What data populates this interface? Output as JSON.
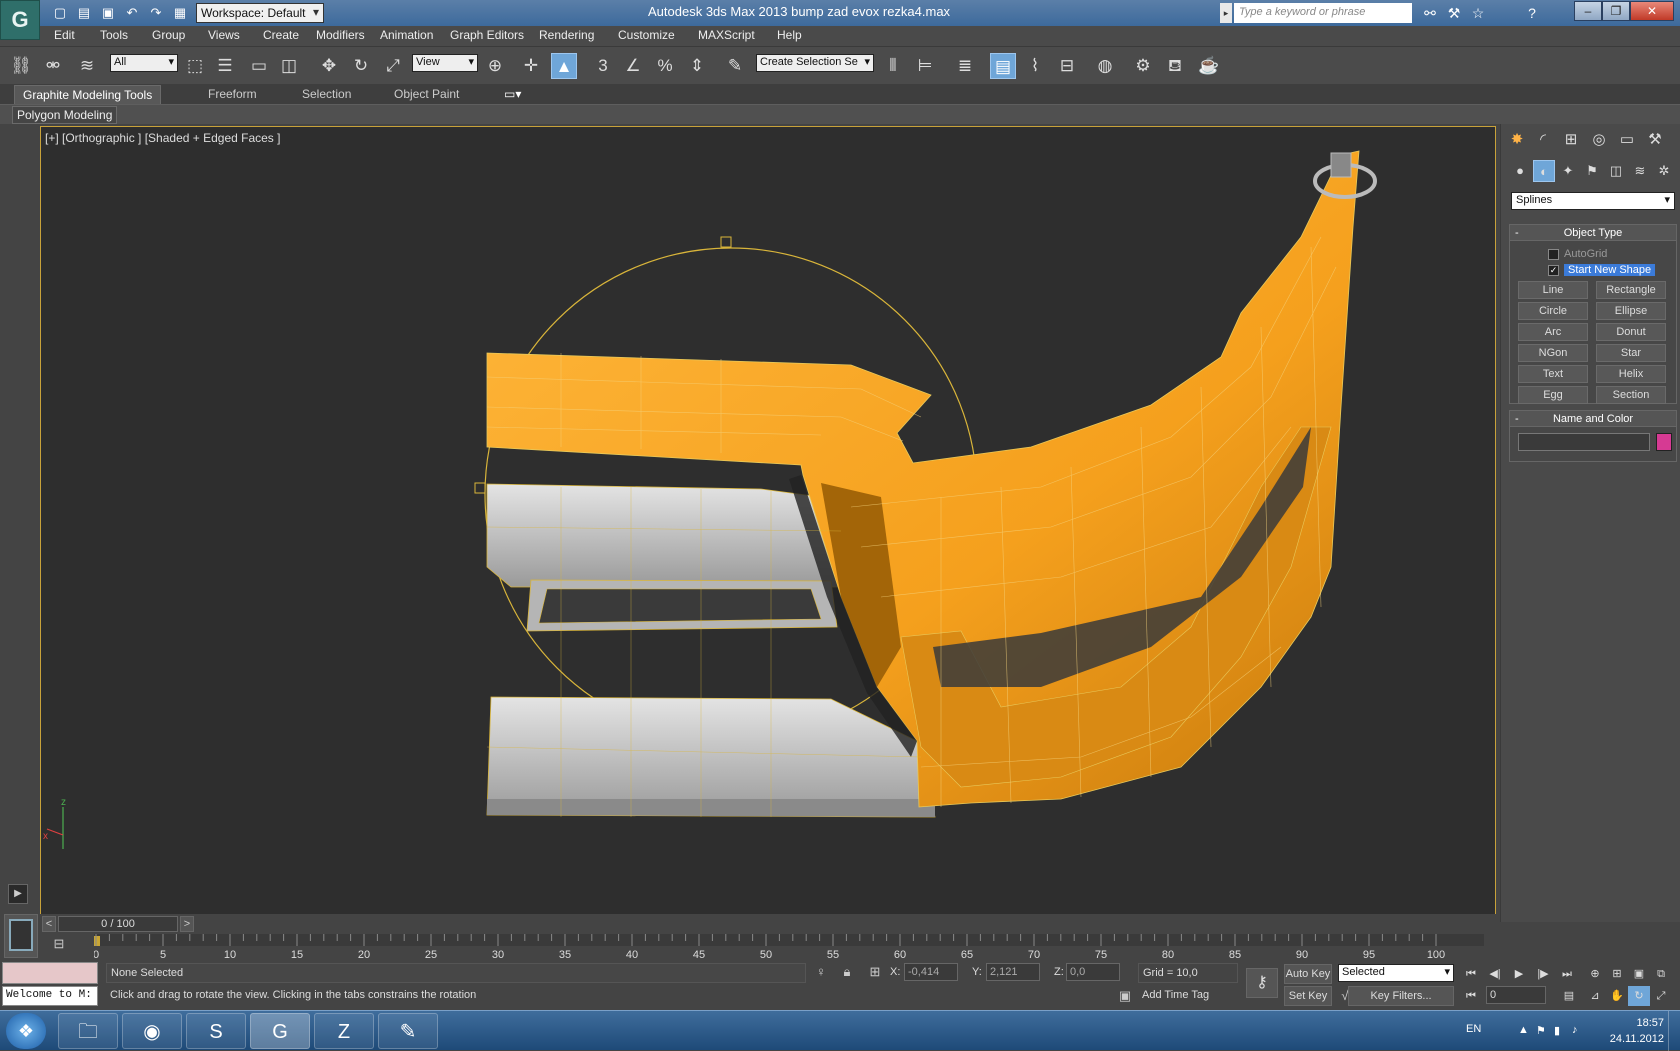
{
  "window": {
    "app_logo": "3ds-max-logo",
    "title": "Autodesk 3ds Max  2013     bump zad evox rezka4.max",
    "workspace": "Workspace: Default",
    "search_placeholder": "Type a keyword or phrase",
    "min": "–",
    "max": "❐",
    "close": "✕"
  },
  "menu": [
    "Edit",
    "Tools",
    "Group",
    "Views",
    "Create",
    "Modifiers",
    "Animation",
    "Graph Editors",
    "Rendering",
    "Customize",
    "MAXScript",
    "Help"
  ],
  "toolbar": {
    "filter_value": "All",
    "ref_coord_value": "View",
    "named_selection_placeholder": "Create Selection Se",
    "snap_label": "3",
    "percent_label": "%"
  },
  "ribbon": {
    "tabs": [
      "Graphite Modeling Tools",
      "Freeform",
      "Selection",
      "Object Paint"
    ],
    "active_tab": "Graphite Modeling Tools",
    "sub_tab": "Polygon Modeling"
  },
  "viewport": {
    "label": "[+] [Orthographic ] [Shaded + Edged Faces ]",
    "axis_x": "x",
    "axis_z": "z",
    "colors": {
      "model_orange": "#f5a623",
      "model_grey": "#cfcfcf",
      "wire": "#e8c95a",
      "bg": "#2e2e2e"
    }
  },
  "command_panel": {
    "category_value": "Splines",
    "object_type_title": "Object Type",
    "autogrid_label": "AutoGrid",
    "start_new_shape_label": "Start New Shape",
    "start_new_shape_checked": "✓",
    "buttons": [
      "Line",
      "Rectangle",
      "Circle",
      "Ellipse",
      "Arc",
      "Donut",
      "NGon",
      "Star",
      "Text",
      "Helix",
      "Egg",
      "Section"
    ],
    "name_and_color_title": "Name and Color",
    "color": "#d63a93"
  },
  "timeline": {
    "slider_label": "0 / 100",
    "prev": "<",
    "next": ">",
    "ticks": [
      "0",
      "5",
      "10",
      "15",
      "20",
      "25",
      "30",
      "35",
      "40",
      "45",
      "50",
      "55",
      "60",
      "65",
      "70",
      "75",
      "80",
      "85",
      "90",
      "95",
      "100"
    ]
  },
  "status": {
    "welcome": "Welcome to M:",
    "selection": "None Selected",
    "prompt": "Click and drag to rotate the view.  Clicking in the tabs constrains the rotation",
    "x_label": "X:",
    "x_value": "-0,414",
    "y_label": "Y:",
    "y_value": "2,121",
    "z_label": "Z:",
    "z_value": "0,0",
    "grid": "Grid = 10,0",
    "add_time_tag": "Add Time Tag",
    "auto_key": "Auto Key",
    "set_key": "Set Key",
    "key_mode_value": "Selected",
    "key_filters": "Key Filters...",
    "frame_value": "0"
  },
  "taskbar": {
    "lang": "EN",
    "time": "18:57",
    "date": "24.11.2012"
  }
}
